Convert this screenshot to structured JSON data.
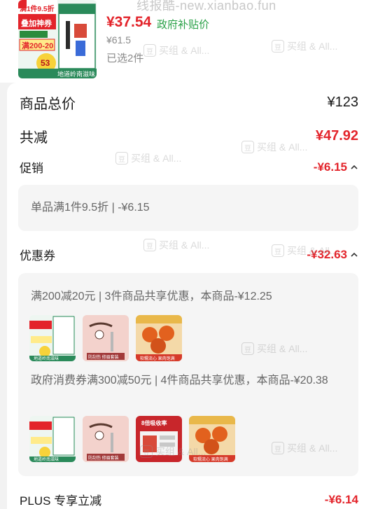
{
  "header": {
    "watermark_site": "线报酷-new.xianbao.fun",
    "price_now": "¥37.54",
    "gov_subsidy_label": "政府补贴价",
    "price_original": "¥61.5",
    "selected_count": "已选2件",
    "product_banner": {
      "line1": "满1件9.5折",
      "line2": "叠加神券",
      "line3": "满200-20",
      "badge": "53",
      "footer": "地道岭南滋味"
    }
  },
  "summary": {
    "total_label": "商品总价",
    "total_value": "¥123",
    "reduce_label": "共减",
    "reduce_value": "¥47.92"
  },
  "promo": {
    "label": "促销",
    "value": "-¥6.15",
    "detail": "单品满1件9.5折 | -¥6.15"
  },
  "coupon": {
    "label": "优惠券",
    "value": "-¥32.63",
    "items": [
      {
        "text": "满200减20元 | 3件商品共享优惠，本商品-¥12.25",
        "thumbs": [
          {
            "kind": "product",
            "caption": "地道岭南滋味"
          },
          {
            "kind": "brow",
            "caption": "防刮伤 修眉套装"
          },
          {
            "kind": "fruit",
            "caption": "软糯流心 果肉饱满"
          }
        ]
      },
      {
        "text": "政府消费券满300减50元 | 4件商品共享优惠，本商品-¥20.38",
        "thumbs": [
          {
            "kind": "product",
            "caption": "地道岭南滋味"
          },
          {
            "kind": "brow",
            "caption": "防刮伤 修眉套装"
          },
          {
            "kind": "redbox",
            "caption": "8倍吸收率"
          },
          {
            "kind": "fruit",
            "caption": "软糯流心 果肉饱满"
          }
        ]
      }
    ]
  },
  "plus": {
    "label": "PLUS 专享立减",
    "value": "-¥6.14"
  },
  "watermark": {
    "text": "买组 & All..."
  },
  "colors": {
    "red": "#e3242b",
    "green": "#28a046",
    "grey": "#8a8a8a"
  }
}
